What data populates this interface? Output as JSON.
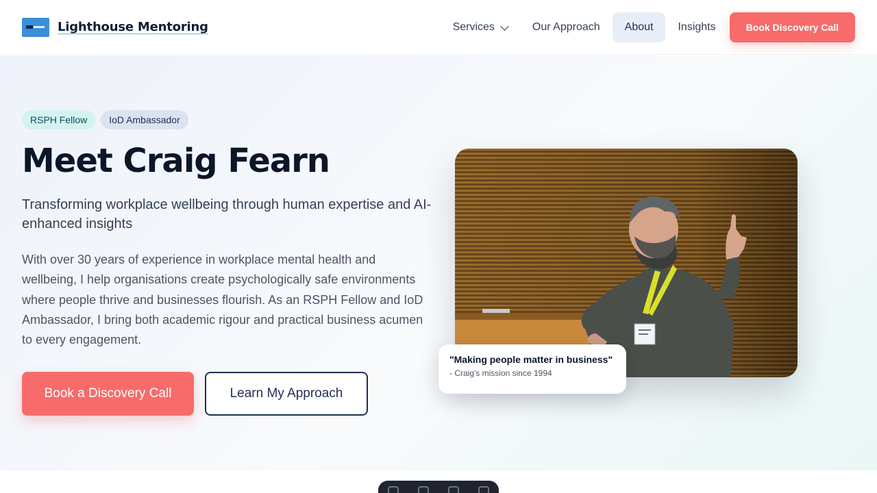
{
  "header": {
    "brand_name": "Lighthouse Mentoring",
    "nav": {
      "services": "Services",
      "approach": "Our Approach",
      "about": "About",
      "insights": "Insights",
      "cta": "Book Discovery Call"
    }
  },
  "hero": {
    "badges": [
      "RSPH Fellow",
      "IoD Ambassador"
    ],
    "title": "Meet Craig Fearn",
    "subtitle": "Transforming workplace wellbeing through human expertise and AI-enhanced insights",
    "body": "With over 30 years of experience in workplace mental health and wellbeing, I help organisations create psychologically safe environments where people thrive and businesses flourish. As an RSPH Fellow and IoD Ambassador, I bring both academic rigour and practical business acumen to every engagement.",
    "primary_button": "Book a Discovery Call",
    "secondary_button": "Learn My Approach",
    "quote": "\"Making people matter in business\"",
    "quote_attribution": "- Craig's mission since 1994"
  },
  "colors": {
    "accent": "#f76b6b",
    "navy": "#1e2f4f",
    "active_nav_bg": "#e8eef8"
  }
}
